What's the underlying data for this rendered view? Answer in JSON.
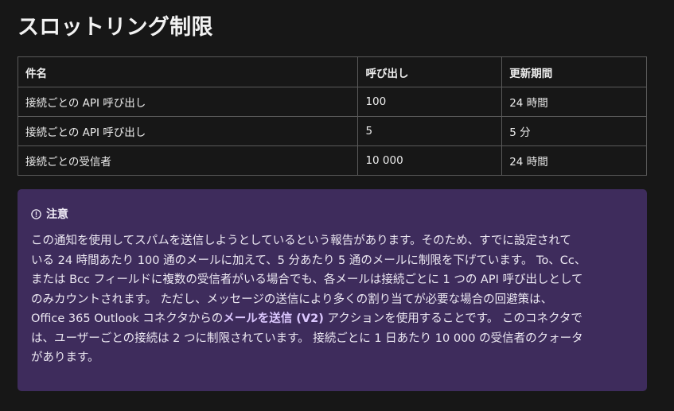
{
  "heading": "スロットリング制限",
  "table": {
    "headers": [
      "件名",
      "呼び出し",
      "更新期間"
    ],
    "rows": [
      [
        "接続ごとの API 呼び出し",
        "100",
        "24 時間"
      ],
      [
        "接続ごとの API 呼び出し",
        "5",
        "5 分"
      ],
      [
        "接続ごとの受信者",
        "10 000",
        "24 時間"
      ]
    ]
  },
  "note": {
    "title": "注意",
    "lines": [
      "この通知を使用してスパムを送信しようとしているという報告があります。そのため、すでに設定されて",
      "いる 24 時間あたり 100 通のメールに加えて、5 分あたり 5 通のメールに制限を下げています。 To、Cc、",
      "または Bcc フィールドに複数の受信者がいる場合でも、各メールは接続ごとに 1 つの API 呼び出しとして",
      "のみカウントされます。 ただし、メッセージの送信により多くの割り当てが必要な場合の回避策は、"
    ],
    "line5_before": "Office 365 Outlook コネクタからの",
    "line5_link": "メールを送信 (V2)",
    "line5_after": " アクションを使用することです。 このコネクタで",
    "lines_end": [
      "は、ユーザーごとの接続は 2 つに制限されています。 接続ごとに 1 日あたり 10 000 の受信者のクォータ",
      "があります。"
    ]
  }
}
